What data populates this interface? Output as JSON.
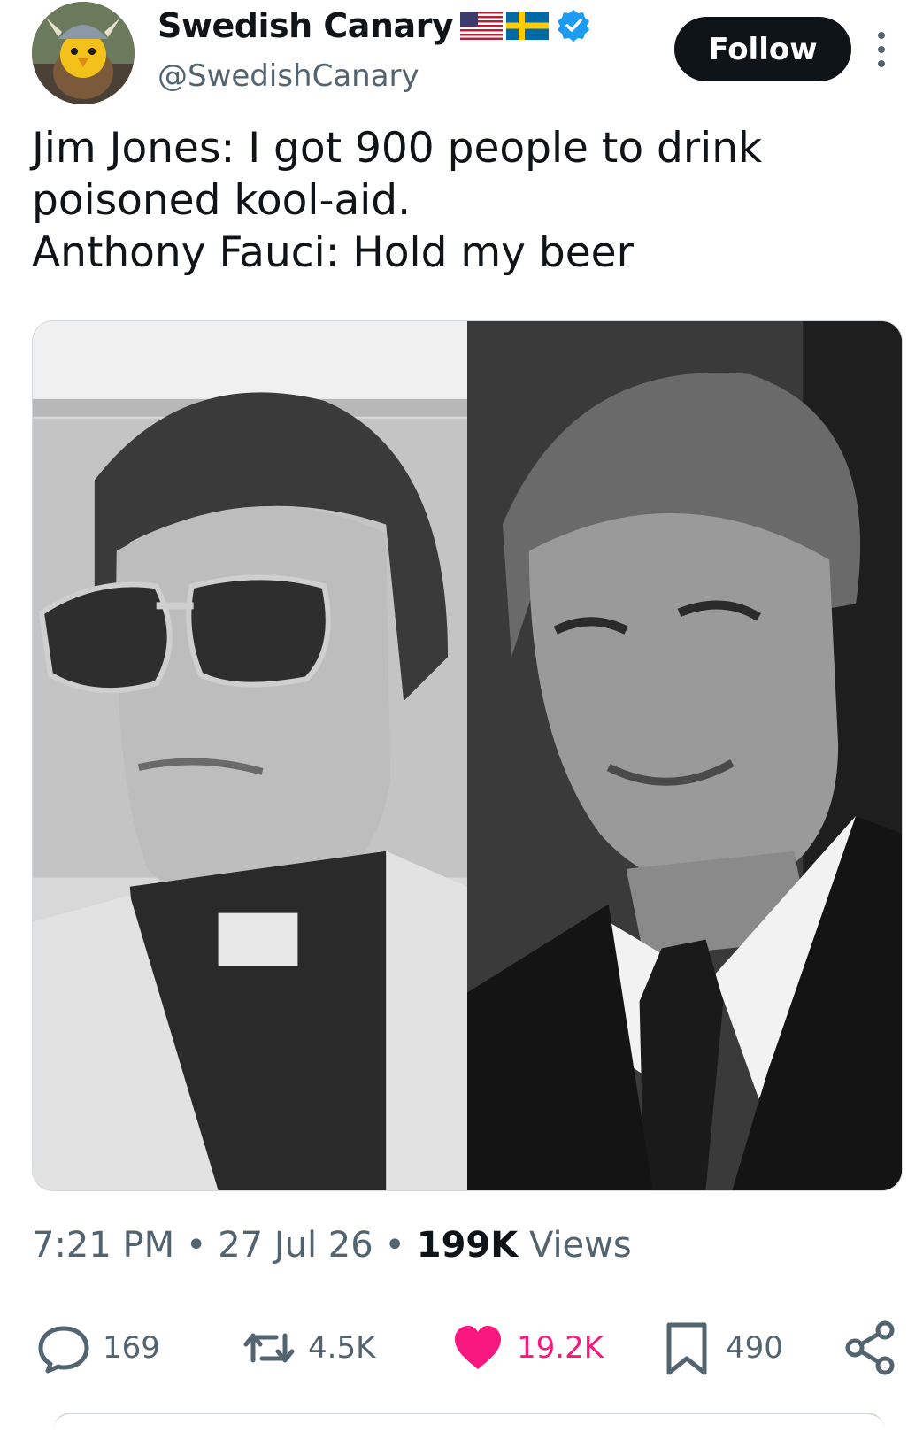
{
  "author": {
    "display_name": "Swedish Canary",
    "handle": "@SwedishCanary",
    "flags": [
      "us-flag-icon",
      "sweden-flag-icon"
    ],
    "verified": true
  },
  "follow_label": "Follow",
  "tweet": {
    "lines": [
      "Jim Jones: I got 900 people to drink",
      "poisoned kool-aid.",
      "Anthony Fauci: Hold my beer"
    ]
  },
  "meta": {
    "time": "7:21 PM",
    "separator": "•",
    "date": "27 Jul 26",
    "views_count": "199K",
    "views_label": "Views"
  },
  "actions": {
    "replies": "169",
    "reposts": "4.5K",
    "likes": "19.2K",
    "bookmarks": "490"
  },
  "colors": {
    "text": "#0f1419",
    "secondary": "#536471",
    "like": "#f91880",
    "verified": "#1d9bf0"
  }
}
